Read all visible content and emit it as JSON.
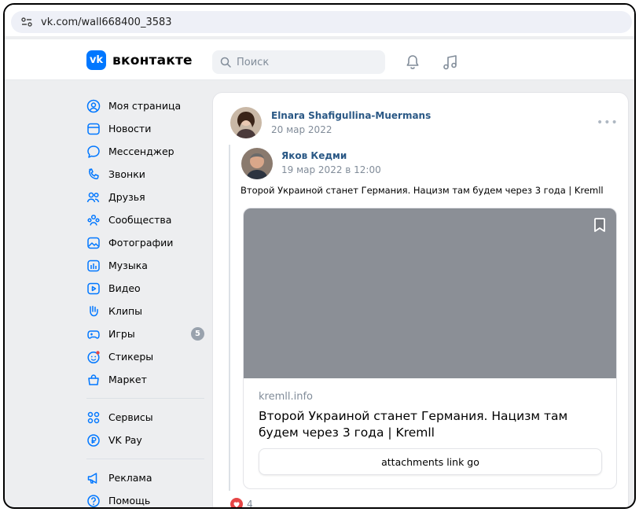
{
  "browser": {
    "url": "vk.com/wall668400_3583"
  },
  "header": {
    "logo_mark": "vk",
    "logo_text": "вконтакте",
    "search_placeholder": "Поиск",
    "icons": [
      "notifications-bell-icon",
      "music-icon"
    ]
  },
  "sidebar": {
    "items": [
      {
        "label": "Моя страница",
        "icon": "user-circle-icon"
      },
      {
        "label": "Новости",
        "icon": "newspaper-icon"
      },
      {
        "label": "Мессенджер",
        "icon": "chat-bubble-icon"
      },
      {
        "label": "Звонки",
        "icon": "phone-icon"
      },
      {
        "label": "Друзья",
        "icon": "friends-icon"
      },
      {
        "label": "Сообщества",
        "icon": "communities-icon"
      },
      {
        "label": "Фотографии",
        "icon": "photo-icon"
      },
      {
        "label": "Музыка",
        "icon": "music-box-icon"
      },
      {
        "label": "Видео",
        "icon": "video-icon"
      },
      {
        "label": "Клипы",
        "icon": "clips-icon"
      },
      {
        "label": "Игры",
        "icon": "gamepad-icon",
        "badge": "5"
      },
      {
        "label": "Стикеры",
        "icon": "sticker-icon"
      },
      {
        "label": "Маркет",
        "icon": "market-bag-icon"
      }
    ],
    "items2": [
      {
        "label": "Сервисы",
        "icon": "services-grid-icon"
      },
      {
        "label": "VK Pay",
        "icon": "vkpay-icon"
      }
    ],
    "items3": [
      {
        "label": "Реклама",
        "icon": "megaphone-icon"
      },
      {
        "label": "Помощь",
        "icon": "help-icon"
      }
    ]
  },
  "post": {
    "author": "Elnara Shafigullina-Muermans",
    "date": "20 мар 2022",
    "repost": {
      "author": "Яков Кедми",
      "date": "19 мар 2022 в 12:00",
      "text": "Второй Украиной станет Германия. Нацизм там будем через 3 года | Kremll"
    },
    "link": {
      "domain": "kremll.info",
      "title": "Второй Украиной станет Германия. Нацизм там будем через 3 года | Kremll",
      "button": "attachments link go"
    },
    "likes": "4"
  },
  "colors": {
    "accent": "#0077ff",
    "link": "#2a5885",
    "secondary": "#818c99",
    "like": "#e64646"
  }
}
